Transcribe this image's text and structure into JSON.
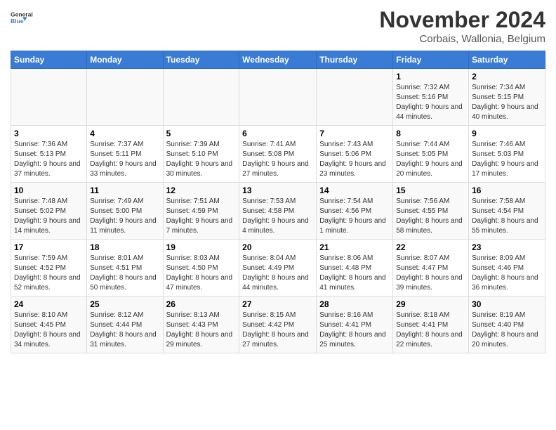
{
  "logo": {
    "general": "General",
    "blue": "Blue"
  },
  "title": "November 2024",
  "subtitle": "Corbais, Wallonia, Belgium",
  "days_header": [
    "Sunday",
    "Monday",
    "Tuesday",
    "Wednesday",
    "Thursday",
    "Friday",
    "Saturday"
  ],
  "weeks": [
    [
      {
        "day": "",
        "info": ""
      },
      {
        "day": "",
        "info": ""
      },
      {
        "day": "",
        "info": ""
      },
      {
        "day": "",
        "info": ""
      },
      {
        "day": "",
        "info": ""
      },
      {
        "day": "1",
        "info": "Sunrise: 7:32 AM\nSunset: 5:16 PM\nDaylight: 9 hours and 44 minutes."
      },
      {
        "day": "2",
        "info": "Sunrise: 7:34 AM\nSunset: 5:15 PM\nDaylight: 9 hours and 40 minutes."
      }
    ],
    [
      {
        "day": "3",
        "info": "Sunrise: 7:36 AM\nSunset: 5:13 PM\nDaylight: 9 hours and 37 minutes."
      },
      {
        "day": "4",
        "info": "Sunrise: 7:37 AM\nSunset: 5:11 PM\nDaylight: 9 hours and 33 minutes."
      },
      {
        "day": "5",
        "info": "Sunrise: 7:39 AM\nSunset: 5:10 PM\nDaylight: 9 hours and 30 minutes."
      },
      {
        "day": "6",
        "info": "Sunrise: 7:41 AM\nSunset: 5:08 PM\nDaylight: 9 hours and 27 minutes."
      },
      {
        "day": "7",
        "info": "Sunrise: 7:43 AM\nSunset: 5:06 PM\nDaylight: 9 hours and 23 minutes."
      },
      {
        "day": "8",
        "info": "Sunrise: 7:44 AM\nSunset: 5:05 PM\nDaylight: 9 hours and 20 minutes."
      },
      {
        "day": "9",
        "info": "Sunrise: 7:46 AM\nSunset: 5:03 PM\nDaylight: 9 hours and 17 minutes."
      }
    ],
    [
      {
        "day": "10",
        "info": "Sunrise: 7:48 AM\nSunset: 5:02 PM\nDaylight: 9 hours and 14 minutes."
      },
      {
        "day": "11",
        "info": "Sunrise: 7:49 AM\nSunset: 5:00 PM\nDaylight: 9 hours and 11 minutes."
      },
      {
        "day": "12",
        "info": "Sunrise: 7:51 AM\nSunset: 4:59 PM\nDaylight: 9 hours and 7 minutes."
      },
      {
        "day": "13",
        "info": "Sunrise: 7:53 AM\nSunset: 4:58 PM\nDaylight: 9 hours and 4 minutes."
      },
      {
        "day": "14",
        "info": "Sunrise: 7:54 AM\nSunset: 4:56 PM\nDaylight: 9 hours and 1 minute."
      },
      {
        "day": "15",
        "info": "Sunrise: 7:56 AM\nSunset: 4:55 PM\nDaylight: 8 hours and 58 minutes."
      },
      {
        "day": "16",
        "info": "Sunrise: 7:58 AM\nSunset: 4:54 PM\nDaylight: 8 hours and 55 minutes."
      }
    ],
    [
      {
        "day": "17",
        "info": "Sunrise: 7:59 AM\nSunset: 4:52 PM\nDaylight: 8 hours and 52 minutes."
      },
      {
        "day": "18",
        "info": "Sunrise: 8:01 AM\nSunset: 4:51 PM\nDaylight: 8 hours and 50 minutes."
      },
      {
        "day": "19",
        "info": "Sunrise: 8:03 AM\nSunset: 4:50 PM\nDaylight: 8 hours and 47 minutes."
      },
      {
        "day": "20",
        "info": "Sunrise: 8:04 AM\nSunset: 4:49 PM\nDaylight: 8 hours and 44 minutes."
      },
      {
        "day": "21",
        "info": "Sunrise: 8:06 AM\nSunset: 4:48 PM\nDaylight: 8 hours and 41 minutes."
      },
      {
        "day": "22",
        "info": "Sunrise: 8:07 AM\nSunset: 4:47 PM\nDaylight: 8 hours and 39 minutes."
      },
      {
        "day": "23",
        "info": "Sunrise: 8:09 AM\nSunset: 4:46 PM\nDaylight: 8 hours and 36 minutes."
      }
    ],
    [
      {
        "day": "24",
        "info": "Sunrise: 8:10 AM\nSunset: 4:45 PM\nDaylight: 8 hours and 34 minutes."
      },
      {
        "day": "25",
        "info": "Sunrise: 8:12 AM\nSunset: 4:44 PM\nDaylight: 8 hours and 31 minutes."
      },
      {
        "day": "26",
        "info": "Sunrise: 8:13 AM\nSunset: 4:43 PM\nDaylight: 8 hours and 29 minutes."
      },
      {
        "day": "27",
        "info": "Sunrise: 8:15 AM\nSunset: 4:42 PM\nDaylight: 8 hours and 27 minutes."
      },
      {
        "day": "28",
        "info": "Sunrise: 8:16 AM\nSunset: 4:41 PM\nDaylight: 8 hours and 25 minutes."
      },
      {
        "day": "29",
        "info": "Sunrise: 8:18 AM\nSunset: 4:41 PM\nDaylight: 8 hours and 22 minutes."
      },
      {
        "day": "30",
        "info": "Sunrise: 8:19 AM\nSunset: 4:40 PM\nDaylight: 8 hours and 20 minutes."
      }
    ]
  ]
}
